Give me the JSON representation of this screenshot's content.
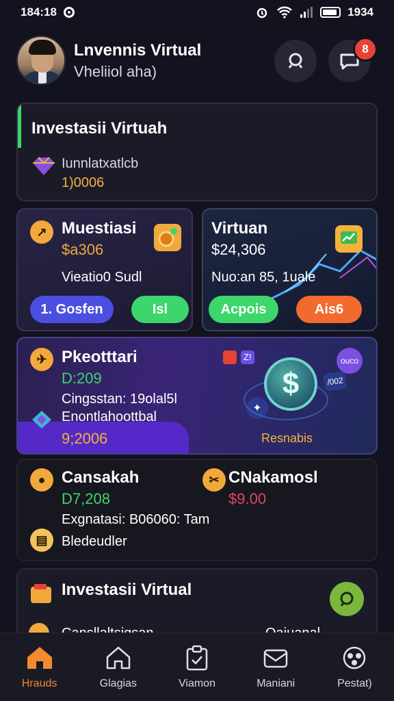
{
  "status_bar": {
    "time": "184:18",
    "right_text": "1934"
  },
  "header": {
    "name": "Lnvennis Virtual",
    "subtitle": "Vheliiol aha)",
    "notification_count": "8"
  },
  "card_summary": {
    "title": "Investasii Virtuah",
    "label": "Iunnlatxatlcb",
    "value": "1)0006"
  },
  "card_left": {
    "title": "Muestiasi",
    "amount": "$a306",
    "desc": "Vieatio0 Sudl",
    "primary_button": "1. Gosfen",
    "secondary_button": "Isl"
  },
  "card_right": {
    "title": "Virtuan",
    "amount": "$24,306",
    "desc": "Nuo:an 85, 1uale",
    "primary_button": "Acpois",
    "secondary_button": "Ais6"
  },
  "card_promo": {
    "title": "Pkeotttari",
    "amount": "D:209",
    "line": "Cingsstan: 19olal5l",
    "label": "Enontlahoottbal",
    "value": "9;2006",
    "action": "Resnabis",
    "badge_top_left": "Z!",
    "badge_small": "ouco",
    "badge_small2": "/002"
  },
  "card_split": {
    "left_title": "Cansakah",
    "left_value": "D7,208",
    "right_title": "CNakamosl",
    "right_value": "$9.00",
    "line": "Exgnatasi: B06060: Tam",
    "label": "Bledeudler"
  },
  "card_bottom": {
    "title": "Investasii Virtual",
    "cut_left": "Cansllaltsigsan",
    "cut_right": "Oaiuanal"
  },
  "nav": [
    {
      "label": "Hrauds",
      "icon": "home-icon"
    },
    {
      "label": "Glagias",
      "icon": "house-outline-icon"
    },
    {
      "label": "Viamon",
      "icon": "clipboard-icon"
    },
    {
      "label": "Maniani",
      "icon": "mail-icon"
    },
    {
      "label": "Pestat)",
      "icon": "settings-globe-icon"
    }
  ],
  "colors": {
    "background": "#13131f",
    "accent_green": "#3dd66a",
    "accent_orange": "#f28a2e",
    "gold": "#f2b23c",
    "purple": "#5b2ad8",
    "red_badge": "#e54335"
  }
}
